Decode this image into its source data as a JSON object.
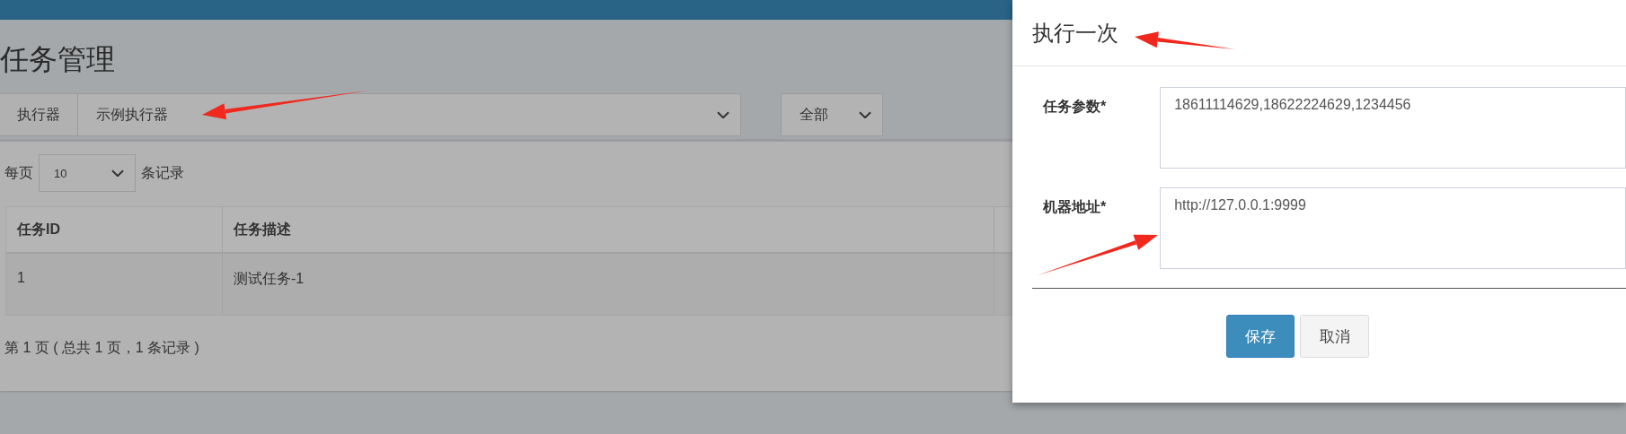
{
  "page_title": "任务管理",
  "filters": {
    "executor": {
      "label": "执行器",
      "value": "示例执行器"
    },
    "status": {
      "value": "全部"
    }
  },
  "page_size": {
    "prefix": "每页",
    "value": "10",
    "suffix": "条记录"
  },
  "table": {
    "columns": [
      "任务ID",
      "任务描述"
    ],
    "rows": [
      [
        "1",
        "测试任务-1"
      ]
    ]
  },
  "pagination": "第 1 页 ( 总共 1 页，1 条记录 )",
  "modal": {
    "title": "执行一次",
    "fields": [
      {
        "label": "任务参数*",
        "value": "18611114629,18622224629,1234456"
      },
      {
        "label": "机器地址*",
        "value": "http://127.0.0.1:9999"
      }
    ],
    "buttons": [
      {
        "label": "保存",
        "kind": "primary"
      },
      {
        "label": "取消",
        "kind": "default"
      }
    ]
  }
}
